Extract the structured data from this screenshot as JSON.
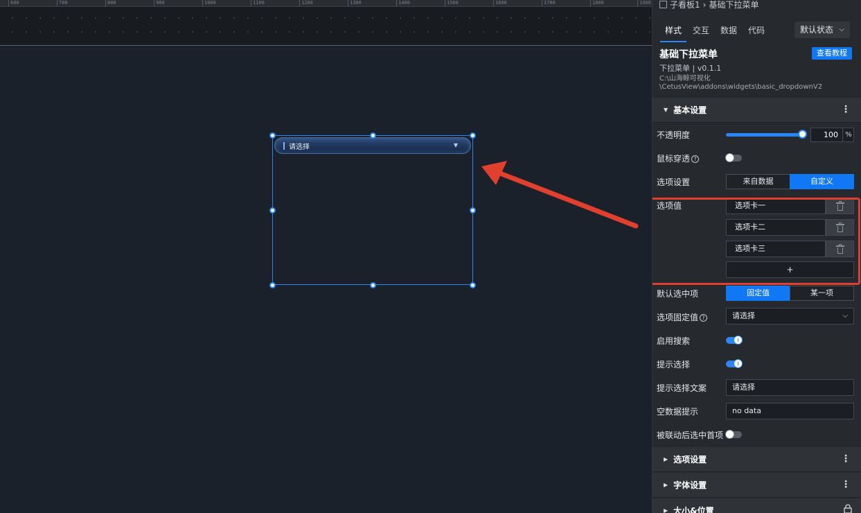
{
  "ruler": {
    "ticks": [
      "600",
      "700",
      "800",
      "900",
      "1000",
      "1100",
      "1200",
      "1300",
      "1400",
      "1500",
      "1600",
      "1700",
      "1800",
      "1900"
    ]
  },
  "canvas": {
    "dropdown_placeholder": "请选择",
    "dropdown_caret": "▼"
  },
  "panel": {
    "breadcrumb": {
      "parent": "子看板1",
      "separator": "›",
      "current": "基础下拉菜单"
    },
    "tabs": [
      "样式",
      "交互",
      "数据",
      "代码"
    ],
    "state_select": {
      "value": "默认状态",
      "chevron": "⌵"
    },
    "widget": {
      "title": "基础下拉菜单",
      "subtitle": "下拉菜单 | v0.1.1",
      "path_line1": "C:\\山海鲸可视化",
      "path_line2": "\\CetusView\\addons\\widgets\\basic_dropdownV2",
      "tutorial_button": "查看教程"
    },
    "basic_section": {
      "title": "基本设置",
      "triangle": "▼",
      "more": "⋮"
    },
    "props": {
      "opacity_label": "不透明度",
      "opacity_value": "100",
      "opacity_unit": "%",
      "opacity_level": 1.0,
      "mouse_through_label": "鼠标穿透",
      "help_glyph": "?",
      "option_settings_label": "选项设置",
      "option_source": [
        "来自数据",
        "自定义"
      ],
      "option_values_label": "选项值",
      "option_values": [
        "选项卡一",
        "选项卡二",
        "选项卡三"
      ],
      "add_option": "+",
      "default_selected_label": "默认选中项",
      "default_selected_modes": [
        "固定值",
        "某一项"
      ],
      "fixed_value_label": "选项固定值",
      "fixed_value": "请选择",
      "fixed_value_chevron": "⌵",
      "enable_search_label": "启用搜索",
      "prompt_select_label": "提示选择",
      "prompt_text_label": "提示选择文案",
      "prompt_text_value": "请选择",
      "empty_data_label": "空数据提示",
      "empty_data_value": "no data",
      "linked_select_first_label": "被联动后选中首项"
    },
    "sections": [
      {
        "title": "选项设置",
        "triangle": "▶",
        "more": "⋮"
      },
      {
        "title": "字体设置",
        "triangle": "▶",
        "more": "⋮"
      },
      {
        "title": "大小&位置",
        "triangle": "▶"
      }
    ]
  },
  "colors": {
    "accent": "#1178f5",
    "annotation": "#e0402d",
    "panel_bg": "#26292e",
    "canvas_bg": "#1b212a"
  }
}
